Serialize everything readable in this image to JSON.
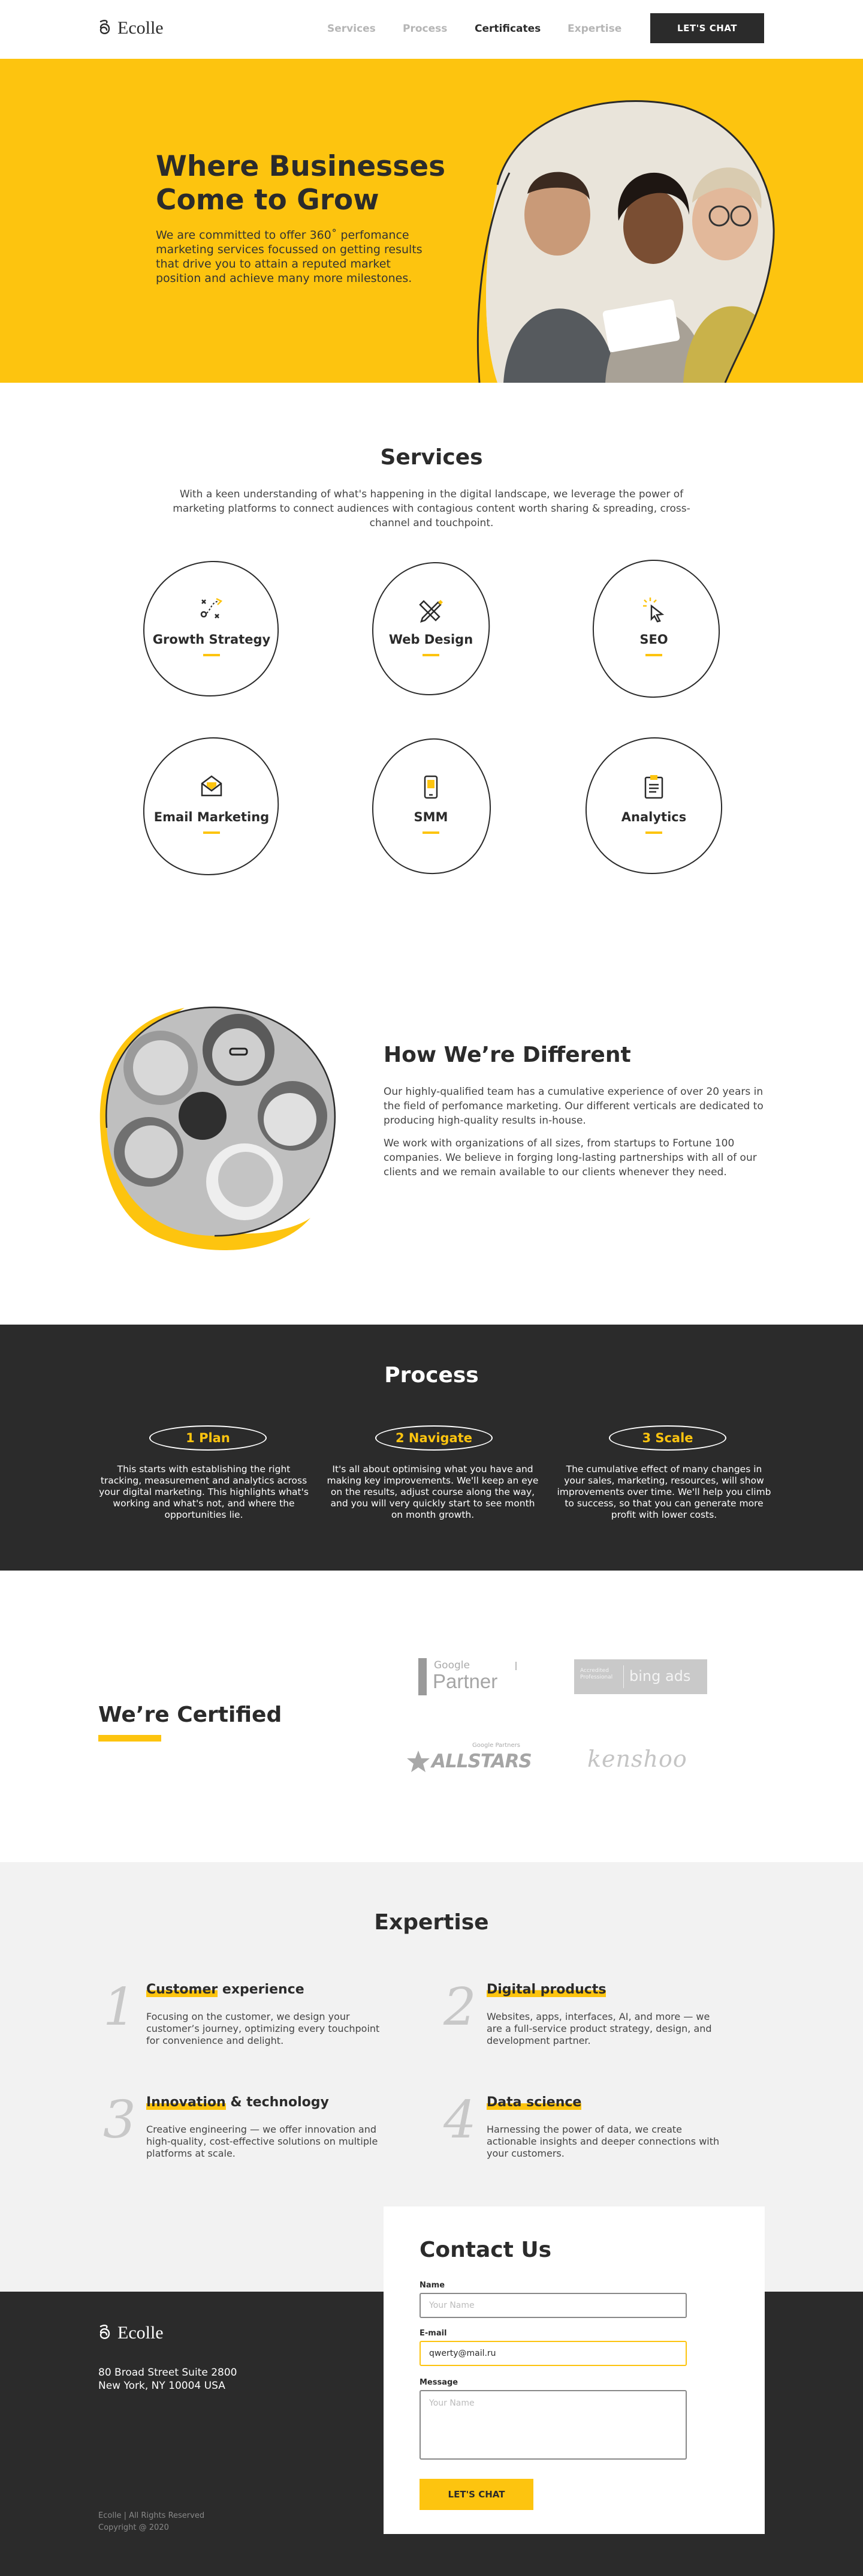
{
  "brand": {
    "name": "Ecolle",
    "accent": "#fdc40f",
    "dark": "#2b2b2b"
  },
  "nav": {
    "items": [
      {
        "label": "Services",
        "active": false
      },
      {
        "label": "Process",
        "active": false
      },
      {
        "label": "Certificates",
        "active": true
      },
      {
        "label": "Expertise",
        "active": false
      }
    ],
    "cta": "LET'S CHAT"
  },
  "hero": {
    "title_line1": "Where Businesses",
    "title_line2": "Come to Grow",
    "text": "We are committed to offer 360˚ perfomance marketing services focussed on getting results that drive you to attain a reputed market position and achieve many more milestones."
  },
  "services": {
    "title": "Services",
    "description": "With a keen understanding of what's happening in the digital landscape, we leverage the power of marketing platforms to connect audiences with contagious content worth sharing & spreading, cross-channel and touchpoint.",
    "items": [
      {
        "label": "Growth Strategy",
        "icon": "strategy-icon"
      },
      {
        "label": "Web Design",
        "icon": "design-tools-icon"
      },
      {
        "label": "SEO",
        "icon": "cursor-click-icon"
      },
      {
        "label": "Email Marketing",
        "icon": "envelope-icon"
      },
      {
        "label": "SMM",
        "icon": "smartphone-icon"
      },
      {
        "label": "Analytics",
        "icon": "clipboard-icon"
      }
    ]
  },
  "different": {
    "title": "How We’re Different",
    "p1": "Our highly-qualified team has a cumulative experience of over 20 years in the field of perfomance marketing. Our different verticals are dedicated to producing high-quality results in-house.",
    "p2": "We work with organizations of all sizes, from startups to Fortune 100 companies. We believe in forging long-lasting partnerships with all of our clients and we remain available to our clients whenever they need."
  },
  "process": {
    "title": "Process",
    "steps": [
      {
        "label": "1  Plan",
        "text": "This starts with establishing the right tracking, measurement and analytics across your digital marketing. This highlights what's working and what's not, and where the opportunities lie."
      },
      {
        "label": "2  Navigate",
        "text": "It's all about optimising what you have and making key improvements. We'll keep an eye on the results, adjust course along the way, and you will very quickly start to see month on month growth."
      },
      {
        "label": "3  Scale",
        "text": "The cumulative effect of many  changes in your sales, marketing, resources, will show improvements over time. We'll help you climb to success, so that you can generate more profit with lower costs."
      }
    ]
  },
  "certified": {
    "title": "We’re Certified",
    "badges": {
      "google_small": "Google",
      "google_big": "Partner",
      "bing_small1": "Accredited",
      "bing_small2": "Professional",
      "bing_big": "bing ads",
      "allstars_small": "Google Partners",
      "allstars_big": "ALLSTARS",
      "kenshoo": "kenshoo"
    }
  },
  "expertise": {
    "title": "Expertise",
    "items": [
      {
        "num": "1",
        "hl": "Customer",
        "rest": " experience",
        "text": "Focusing on the customer, we design your customer’s journey, optimizing every touchpoint for convenience and delight."
      },
      {
        "num": "2",
        "hl": "Digital products",
        "rest": "",
        "text": "Websites, apps, interfaces, AI, and more — we are a full-service product strategy, design, and development partner."
      },
      {
        "num": "3",
        "hl": "Innovation",
        "rest": " & technology",
        "text": "Creative engineering — we offer innovation and high-quality, cost-effective solutions on multiple platforms at scale."
      },
      {
        "num": "4",
        "hl": "Data science",
        "rest": "",
        "text": "Harnessing the power of data, we create actionable insights and deeper connections with your customers."
      }
    ]
  },
  "footer": {
    "address1": "80 Broad Street Suite 2800",
    "address2": "New York, NY 10004 USA",
    "copy1": "Ecolle | All Rights Reserved",
    "copy2": "Copyright @ 2020"
  },
  "contact": {
    "title": "Contact Us",
    "name_label": "Name",
    "name_placeholder": "Your Name",
    "email_label": "E-mail",
    "email_value": "qwerty@mail.ru",
    "message_label": "Message",
    "message_placeholder": "Your Name",
    "submit": "LET'S CHAT"
  }
}
